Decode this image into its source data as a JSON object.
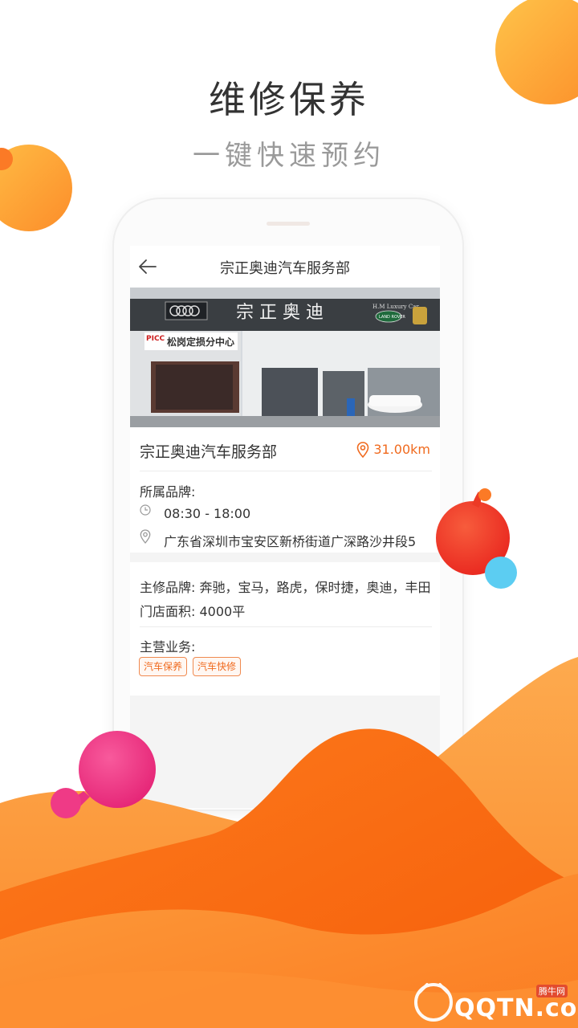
{
  "promo": {
    "headline": "维修保养",
    "subline": "一键快速预约"
  },
  "nav": {
    "title": "宗正奥迪汽车服务部"
  },
  "shop": {
    "name": "宗正奥迪汽车服务部",
    "distance": "31.00km",
    "brand_label": "所属品牌:",
    "hours": "08:30 - 18:00",
    "address": "广东省深圳市宝安区新桥街道广深路沙井段5"
  },
  "photo": {
    "sign_main": "宗 正 奥 迪",
    "sign_side": "松岗定损分中心",
    "sign_picc": "PICC",
    "sign_luxury": "H.M Luxury Car",
    "sign_landrover": "LAND ROVER"
  },
  "details": {
    "repair_brands": "主修品牌: 奔驰，宝马，路虎，保时捷，奥迪，丰田",
    "area": "门店面积: 4000平",
    "business_label": "主营业务:",
    "tags": [
      "汽车保养",
      "汽车快修"
    ]
  },
  "watermark": {
    "text": "QQTN.com",
    "small": "腾牛网"
  },
  "colors": {
    "accent": "#f06a1e",
    "wave_dark": "#fb6e10",
    "wave_light": "#fc9a3c",
    "bubble_red": "#f2402c",
    "bubble_pink": "#ef3a86",
    "bubble_blue": "#5ccdf2",
    "bubble_yellow": "#fdb13a"
  }
}
